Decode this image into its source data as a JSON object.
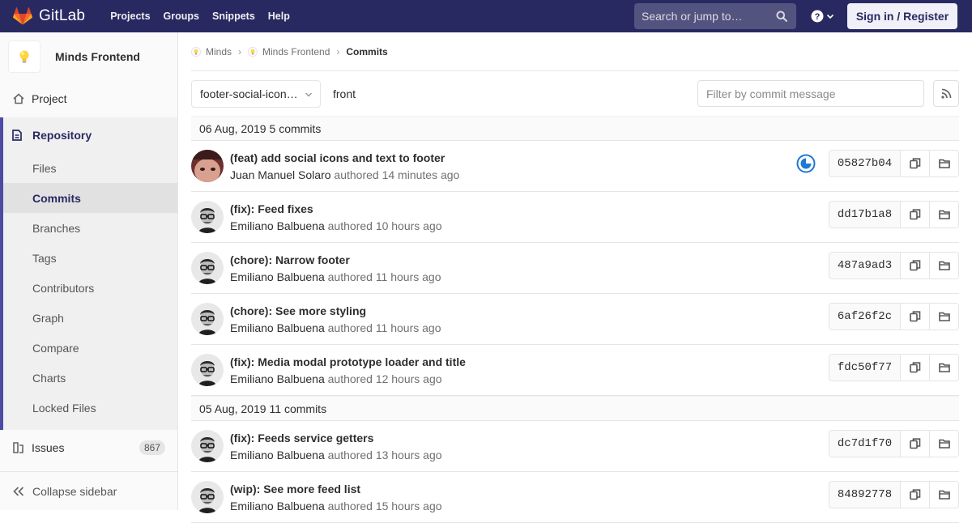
{
  "navbar": {
    "brand": "GitLab",
    "links": [
      "Projects",
      "Groups",
      "Snippets",
      "Help"
    ],
    "search_placeholder": "Search or jump to…",
    "signin_label": "Sign in / Register"
  },
  "sidebar": {
    "project_name": "Minds Frontend",
    "project_item": "Project",
    "repository_label": "Repository",
    "repository_items": [
      "Files",
      "Commits",
      "Branches",
      "Tags",
      "Contributors",
      "Graph",
      "Compare",
      "Charts",
      "Locked Files"
    ],
    "active_item": "Commits",
    "issues_label": "Issues",
    "issues_count": "867",
    "collapse_label": "Collapse sidebar"
  },
  "breadcrumb": [
    "Minds",
    "Minds Frontend",
    "Commits"
  ],
  "toolbar": {
    "branch": "footer-social-icon…",
    "path": "front",
    "filter_placeholder": "Filter by commit message"
  },
  "days": [
    {
      "date": "06 Aug, 2019",
      "count": "5 commits",
      "commits": [
        {
          "title": "(feat) add social icons and text to footer",
          "author": "Juan Manuel Solaro",
          "verb": "authored",
          "time": "14 minutes ago",
          "sha": "05827b04",
          "pipeline": "running",
          "avatar": "juan"
        },
        {
          "title": "(fix): Feed fixes",
          "author": "Emiliano Balbuena",
          "verb": "authored",
          "time": "10 hours ago",
          "sha": "dd17b1a8",
          "pipeline": "",
          "avatar": "emiliano"
        },
        {
          "title": "(chore): Narrow footer",
          "author": "Emiliano Balbuena",
          "verb": "authored",
          "time": "11 hours ago",
          "sha": "487a9ad3",
          "pipeline": "",
          "avatar": "emiliano"
        },
        {
          "title": "(chore): See more styling",
          "author": "Emiliano Balbuena",
          "verb": "authored",
          "time": "11 hours ago",
          "sha": "6af26f2c",
          "pipeline": "",
          "avatar": "emiliano"
        },
        {
          "title": "(fix): Media modal prototype loader and title",
          "author": "Emiliano Balbuena",
          "verb": "authored",
          "time": "12 hours ago",
          "sha": "fdc50f77",
          "pipeline": "",
          "avatar": "emiliano"
        }
      ]
    },
    {
      "date": "05 Aug, 2019",
      "count": "11 commits",
      "commits": [
        {
          "title": "(fix): Feeds service getters",
          "author": "Emiliano Balbuena",
          "verb": "authored",
          "time": "13 hours ago",
          "sha": "dc7d1f70",
          "pipeline": "",
          "avatar": "emiliano"
        },
        {
          "title": "(wip): See more feed list",
          "author": "Emiliano Balbuena",
          "verb": "authored",
          "time": "15 hours ago",
          "sha": "84892778",
          "pipeline": "",
          "avatar": "emiliano"
        }
      ]
    }
  ],
  "icons": {
    "search": "search-icon",
    "help": "help-icon",
    "copy": "copy-icon",
    "browse": "folder-icon",
    "rss": "rss-icon",
    "pipeline_running": "status-running-icon"
  },
  "colors": {
    "navbar": "#292961",
    "accent": "#4b4ba3",
    "pipeline": "#1f78d1"
  }
}
